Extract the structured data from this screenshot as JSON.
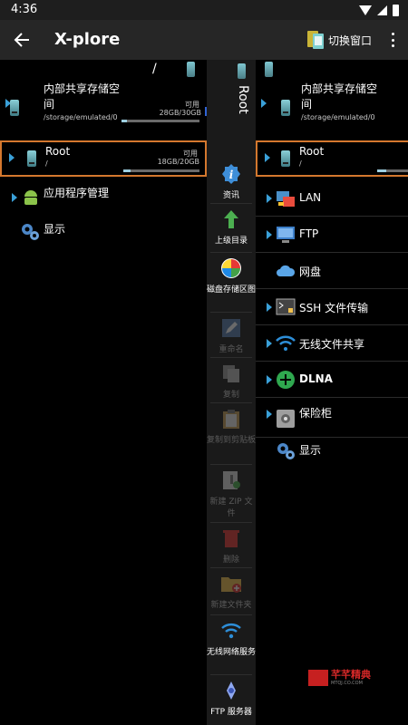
{
  "status": {
    "time": "4:36"
  },
  "appbar": {
    "title": "X-plore",
    "switch_label": "切换窗口"
  },
  "left_pane": {
    "path": "/",
    "entries": [
      {
        "title_line1": "内部共享存储空",
        "title_line2": "间",
        "path": "/storage/emulated/0",
        "avail_label": "可用",
        "size": "28GB/30GB",
        "usage": 0.07
      },
      {
        "title_line1": "Root",
        "title_line2": "",
        "path": "/",
        "avail_label": "可用",
        "size": "18GB/20GB",
        "usage": 0.1
      }
    ],
    "menu": [
      {
        "label": "应用程序管理"
      },
      {
        "label": "显示"
      }
    ]
  },
  "right_pane": {
    "root_vertical": "Root",
    "entries": [
      {
        "title_line1": "内部共享存储空",
        "title_line2": "间",
        "path": "/storage/emulated/0"
      },
      {
        "title_line1": "Root",
        "path": "/"
      }
    ],
    "menu": [
      {
        "label": "LAN"
      },
      {
        "label": "FTP"
      },
      {
        "label": "网盘"
      },
      {
        "label": "SSH 文件传输"
      },
      {
        "label": "无线文件共享"
      },
      {
        "label": "DLNA"
      },
      {
        "label": "保险柜"
      },
      {
        "label": "显示"
      }
    ]
  },
  "toolbar": [
    {
      "label": "资讯",
      "enabled": true
    },
    {
      "label": "上级目录",
      "enabled": true
    },
    {
      "label": "磁盘存储区图",
      "enabled": true
    },
    {
      "label": "重命名",
      "enabled": false
    },
    {
      "label": "复制",
      "enabled": false
    },
    {
      "label": "复制到剪贴板",
      "enabled": false
    },
    {
      "label": "新建 ZIP 文件",
      "enabled": false
    },
    {
      "label": "删除",
      "enabled": false
    },
    {
      "label": "新建文件夹",
      "enabled": false
    },
    {
      "label": "无线网络服务",
      "enabled": true
    },
    {
      "label": "FTP 服务器",
      "enabled": true
    }
  ],
  "watermark": {
    "text": "芊芊精典",
    "sub": "MTQJ.CO.COM"
  },
  "colors": {
    "accent_border": "#d4782e",
    "arrow": "#2f63d4",
    "triangle": "#3aa0d8"
  }
}
